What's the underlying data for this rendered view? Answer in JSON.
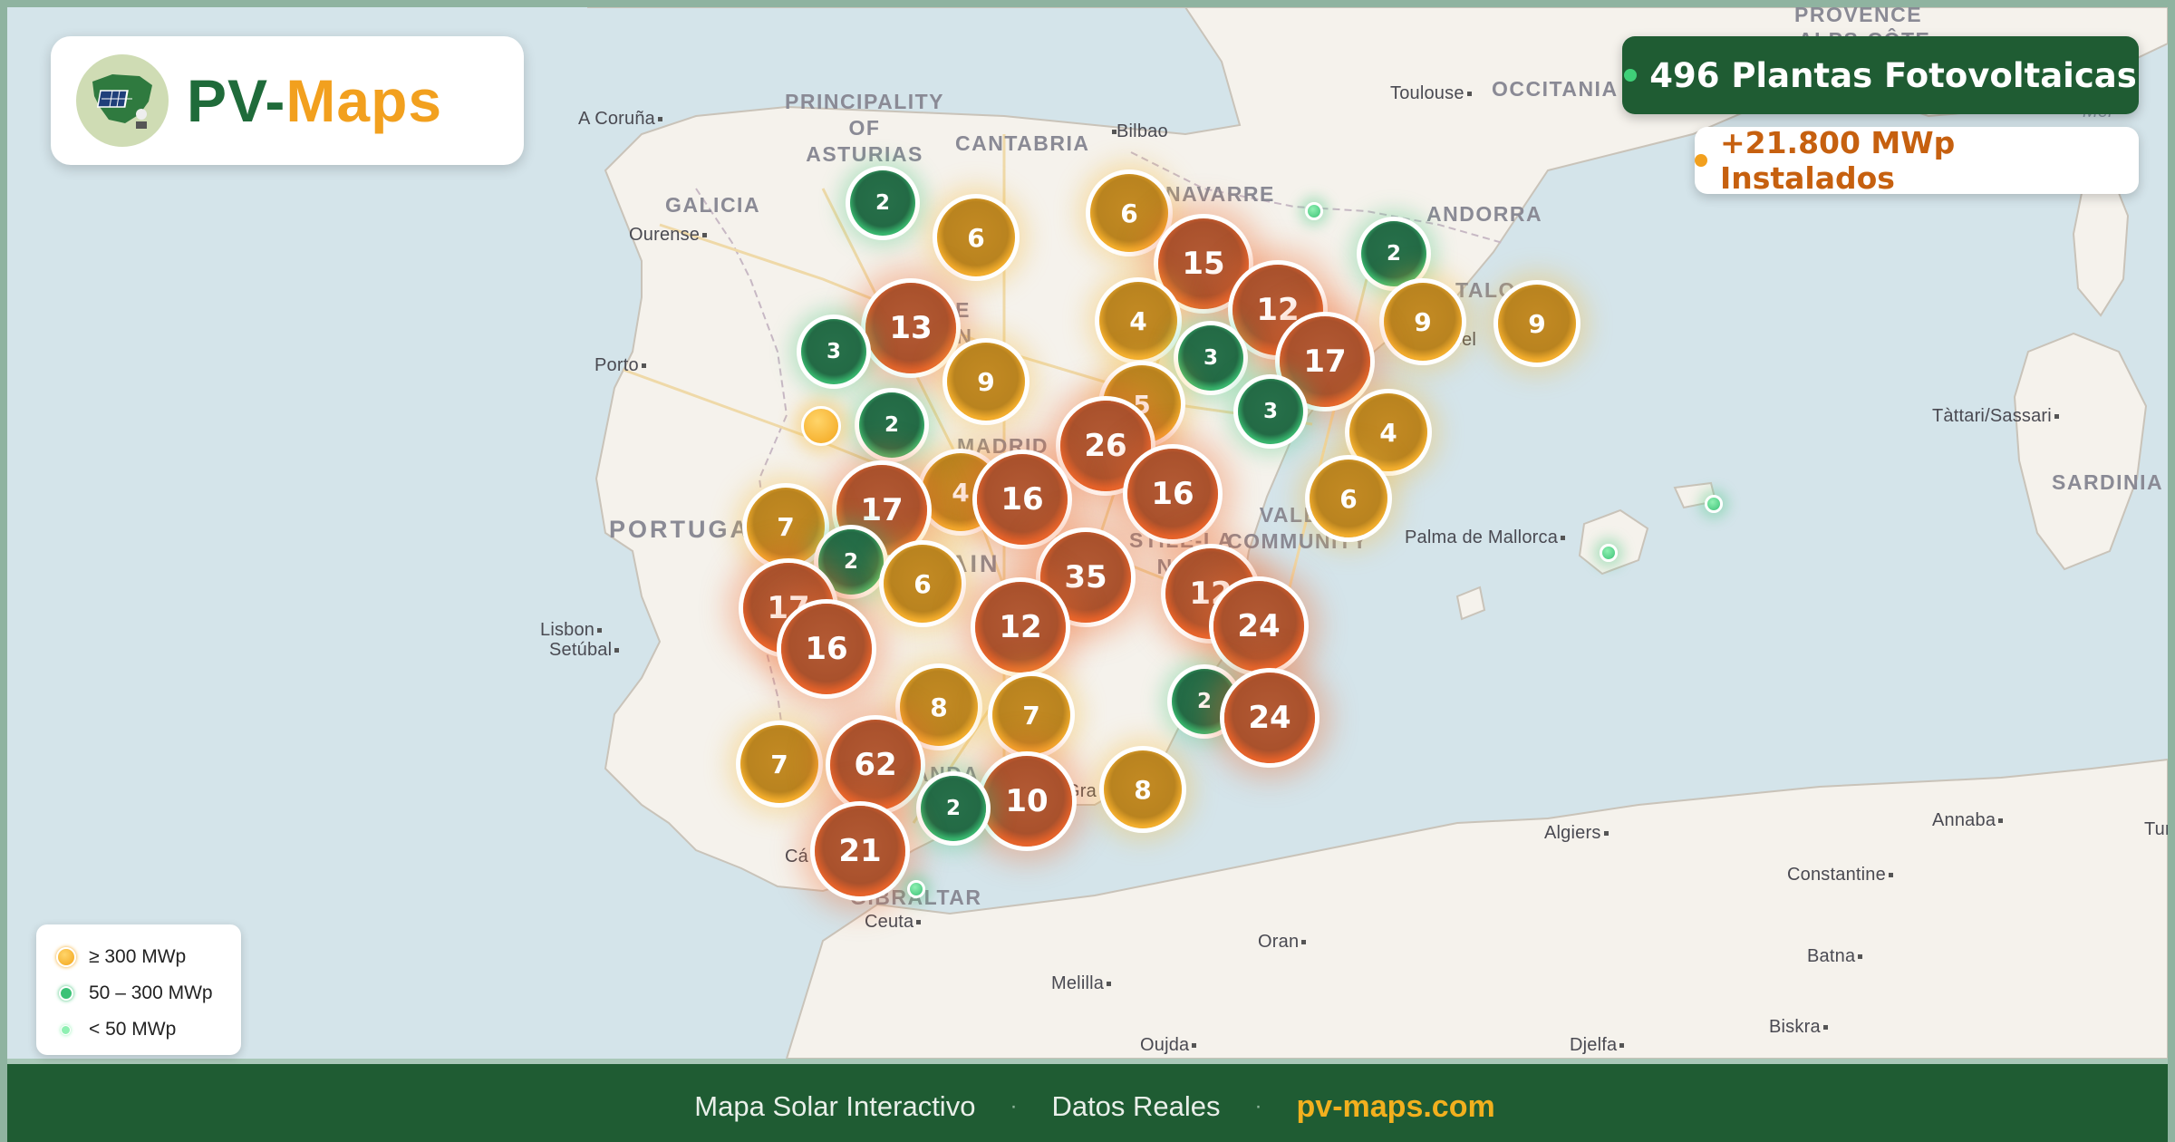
{
  "brand": {
    "pv": "PV",
    "dash": "-",
    "maps": "Maps"
  },
  "stats": {
    "plants": "496 Plantas Fotovoltaicas",
    "capacity": "+21.800 MWp Instalados",
    "plants_dot_color": "#3fd078",
    "capacity_dot_color": "#f2a01e"
  },
  "legend": [
    {
      "label": "≥ 300 MWp",
      "color": "#f3a51c",
      "icon": "orange-dot-icon"
    },
    {
      "label": "50 – 300 MWp",
      "color": "#3cc277",
      "icon": "green-dot-icon"
    },
    {
      "label": "< 50 MWp",
      "color": "#8ff0b2",
      "icon": "light-green-dot-icon"
    }
  ],
  "footer": {
    "tagline": "Mapa Solar Interactivo",
    "sep1": "·",
    "data": "Datos Reales",
    "sep2": "·",
    "url": "pv-maps.com"
  },
  "map": {
    "places": [
      {
        "name": "A Coruña"
      },
      {
        "name": "Ourense"
      },
      {
        "name": "Porto"
      },
      {
        "name": "Lisbon"
      },
      {
        "name": "Setúbal"
      },
      {
        "name": "Bilbao"
      },
      {
        "name": "Toulouse"
      },
      {
        "name": "Palma de Mallorca"
      },
      {
        "name": "Tàttari/Sassari"
      },
      {
        "name": "Algiers"
      },
      {
        "name": "Annaba"
      },
      {
        "name": "Constantine"
      },
      {
        "name": "Oran"
      },
      {
        "name": "Melilla"
      },
      {
        "name": "Oujda"
      },
      {
        "name": "Djelfa"
      },
      {
        "name": "Batna"
      },
      {
        "name": "Biskra"
      },
      {
        "name": "Ceuta"
      },
      {
        "name": "Cá"
      },
      {
        "name": "Gra"
      },
      {
        "name": "Tun"
      }
    ],
    "regions": [
      {
        "name": "PRINCIPALITY\nOF\nASTURIAS"
      },
      {
        "name": "CANTABRIA"
      },
      {
        "name": "GALICIA"
      },
      {
        "name": "NAVARRE"
      },
      {
        "name": "ANDORRA"
      },
      {
        "name": "OCCITANIA"
      },
      {
        "name": "PORTUGA"
      },
      {
        "name": "MADRID"
      },
      {
        "name": "VALEN\nCOMMUNITY"
      },
      {
        "name": "SARDINIA"
      },
      {
        "name": "GIBRALTAR"
      },
      {
        "name": "PROVENCE"
      },
      {
        "name": "ALPS-CÔTE"
      },
      {
        "name": "TALO"
      },
      {
        "name": "rcel"
      },
      {
        "name": "AIN"
      },
      {
        "name": "STILE-LA\nNCH"
      },
      {
        "name": "LE\nÓN"
      },
      {
        "name": "ANDA"
      },
      {
        "name": "Mer"
      }
    ],
    "clusters": [
      {
        "count": "2",
        "tier": "green"
      },
      {
        "count": "6",
        "tier": "orange"
      },
      {
        "count": "6",
        "tier": "orange"
      },
      {
        "count": "15",
        "tier": "red"
      },
      {
        "count": "2",
        "tier": "green"
      },
      {
        "count": "13",
        "tier": "red"
      },
      {
        "count": "3",
        "tier": "green"
      },
      {
        "count": "4",
        "tier": "orange"
      },
      {
        "count": "12",
        "tier": "red"
      },
      {
        "count": "9",
        "tier": "orange"
      },
      {
        "count": "9",
        "tier": "orange"
      },
      {
        "count": "9",
        "tier": "orange"
      },
      {
        "count": "3",
        "tier": "green"
      },
      {
        "count": "17",
        "tier": "red"
      },
      {
        "count": "5",
        "tier": "orange"
      },
      {
        "count": "2",
        "tier": "green"
      },
      {
        "count": "3",
        "tier": "green"
      },
      {
        "count": "4",
        "tier": "orange"
      },
      {
        "count": "26",
        "tier": "red"
      },
      {
        "count": "4",
        "tier": "orange"
      },
      {
        "count": "16",
        "tier": "red"
      },
      {
        "count": "16",
        "tier": "red"
      },
      {
        "count": "6",
        "tier": "orange"
      },
      {
        "count": "17",
        "tier": "red"
      },
      {
        "count": "7",
        "tier": "orange"
      },
      {
        "count": "2",
        "tier": "green"
      },
      {
        "count": "6",
        "tier": "orange"
      },
      {
        "count": "17",
        "tier": "red"
      },
      {
        "count": "12",
        "tier": "red"
      },
      {
        "count": "35",
        "tier": "red"
      },
      {
        "count": "16",
        "tier": "red"
      },
      {
        "count": "12",
        "tier": "red"
      },
      {
        "count": "24",
        "tier": "red"
      },
      {
        "count": "8",
        "tier": "orange"
      },
      {
        "count": "7",
        "tier": "orange"
      },
      {
        "count": "2",
        "tier": "green"
      },
      {
        "count": "24",
        "tier": "red"
      },
      {
        "count": "7",
        "tier": "orange"
      },
      {
        "count": "62",
        "tier": "red"
      },
      {
        "count": "10",
        "tier": "red"
      },
      {
        "count": "8",
        "tier": "orange"
      },
      {
        "count": "2",
        "tier": "green"
      },
      {
        "count": "21",
        "tier": "red"
      }
    ],
    "singles": [
      {
        "tier": "orange"
      },
      {
        "tier": "green"
      },
      {
        "tier": "green"
      },
      {
        "tier": "green"
      },
      {
        "tier": "green"
      }
    ]
  }
}
